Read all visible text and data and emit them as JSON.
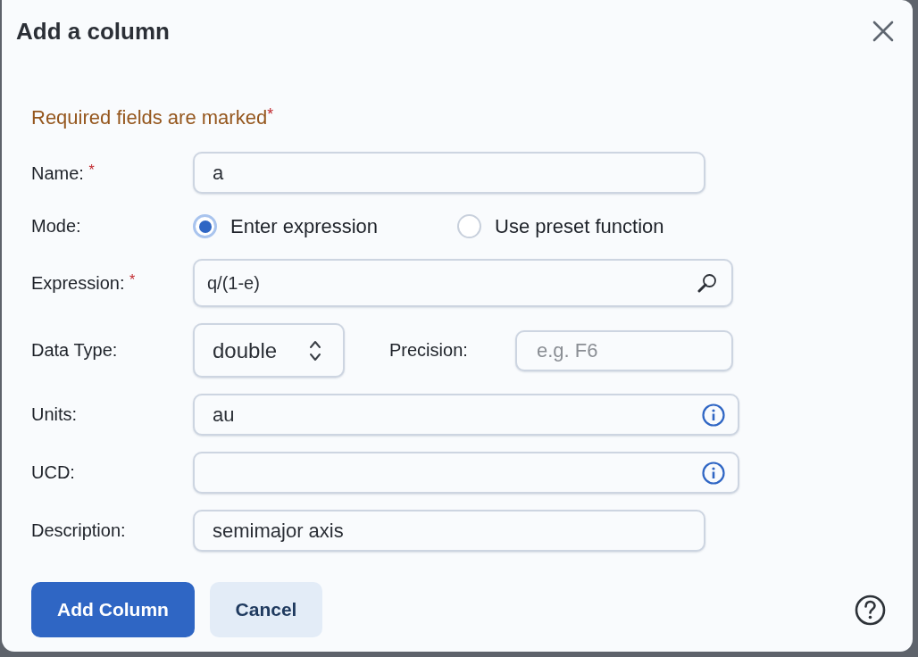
{
  "dialog": {
    "title": "Add a column"
  },
  "required_note": {
    "text": "Required fields are marked",
    "mark": "*"
  },
  "fields": [
    {
      "kind": "text",
      "label": "Name:",
      "required_mark": "*",
      "value": "a"
    },
    {
      "kind": "radio",
      "label": "Mode:",
      "options": [
        {
          "label": "Enter expression",
          "selected": true
        },
        {
          "label": "Use preset function",
          "selected": false
        }
      ]
    },
    {
      "kind": "search",
      "label": "Expression:",
      "required_mark": "*",
      "value": "q/(1-e)"
    },
    {
      "kind": "select",
      "label": "Data Type:",
      "value": "double",
      "side_field": {
        "label": "Precision:",
        "placeholder": "e.g. F6"
      }
    },
    {
      "kind": "info",
      "label": "Units:",
      "value": "au"
    },
    {
      "kind": "info",
      "label": "UCD:"
    },
    {
      "kind": "text",
      "label": "Description:",
      "value": "semimajor axis"
    }
  ],
  "buttons": [
    {
      "label": "Add Column",
      "kind": "primary"
    },
    {
      "label": "Cancel",
      "kind": "secondary"
    }
  ]
}
